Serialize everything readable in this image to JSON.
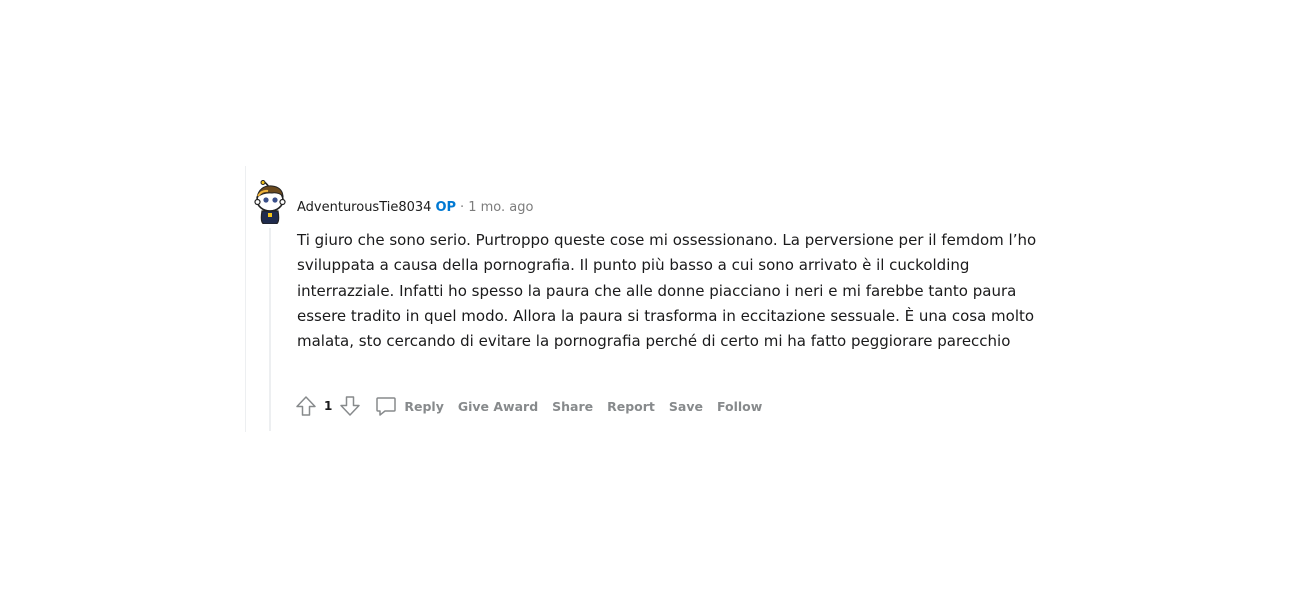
{
  "comment": {
    "author": "AdventurousTie8034",
    "op_badge": "OP",
    "separator": "·",
    "timestamp": "1 mo. ago",
    "avatar_icon": "snoo-avatar-icon",
    "body": "Ti giuro che sono serio. Purtroppo queste cose mi ossessionano. La perversione per il femdom l’ho sviluppata a causa della pornografia. Il punto più basso a cui sono arrivato è il cuckolding interrazziale. Infatti ho spesso la paura che alle donne piacciano i neri e mi farebbe tanto paura essere tradito in quel modo. Allora la paura si trasforma in eccitazione sessuale. È una cosa molto malata, sto cercando di evitare la pornografia perché di certo mi ha fatto peggiorare parecchio",
    "score": "1"
  },
  "actions": {
    "upvote_icon": "upvote-arrow-icon",
    "downvote_icon": "downvote-arrow-icon",
    "reply_icon": "comment-bubble-icon",
    "reply": "Reply",
    "give_award": "Give Award",
    "share": "Share",
    "report": "Report",
    "save": "Save",
    "follow": "Follow"
  },
  "colors": {
    "op_badge": "#0079d3",
    "action_text": "#878a8c",
    "body_text": "#1a1a1b",
    "thread_line": "#edeff1"
  }
}
